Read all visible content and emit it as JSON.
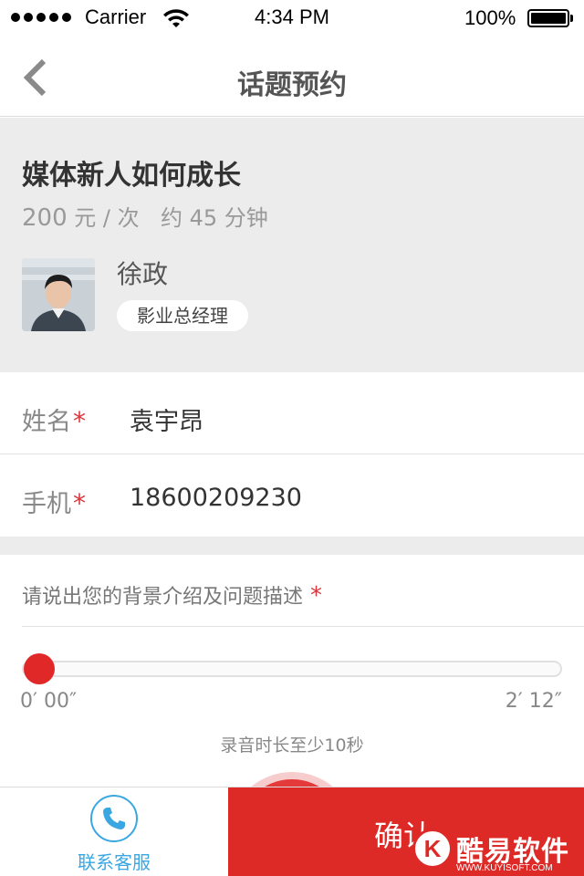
{
  "status_bar": {
    "carrier": "Carrier",
    "time": "4:34 PM",
    "battery": "100%"
  },
  "nav": {
    "title": "话题预约",
    "back_icon": "chevron-left-icon"
  },
  "topic": {
    "title": "媒体新人如何成长",
    "price_amount": "200",
    "price_unit": "元 / 次",
    "duration": "约 45 分钟",
    "expert": {
      "name": "徐政",
      "position": "影业总经理"
    }
  },
  "form": {
    "name_label": "姓名",
    "name_value": "袁宇昂",
    "phone_label": "手机",
    "phone_value": "18600209230",
    "required_mark": "*"
  },
  "recording": {
    "prompt": "请说出您的背景介绍及问题描述",
    "required_mark": "*",
    "start_time": "0′ 00″",
    "end_time": "2′ 12″",
    "progress_fraction": 0,
    "hint": "录音时长至少10秒"
  },
  "bottom": {
    "service_label": "联系客服",
    "service_icon": "phone-icon",
    "confirm_label": "确认"
  },
  "watermark": {
    "logo_letter": "K",
    "text": "酷易软件园",
    "url": "WWW.KUYISOFT.COM"
  },
  "colors": {
    "accent_red": "#dd2a27",
    "service_blue": "#3aa7e2",
    "card_bg": "#ececec"
  }
}
